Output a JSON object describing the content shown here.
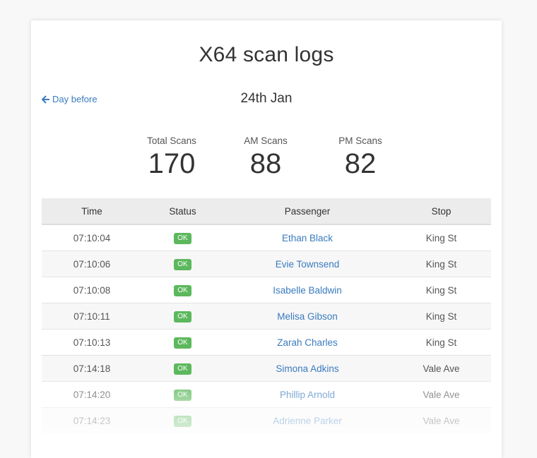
{
  "page": {
    "title": "X64 scan logs",
    "date": "24th Jan",
    "nav": {
      "day_before_label": "Day before"
    }
  },
  "stats": {
    "total": {
      "label": "Total Scans",
      "value": "170"
    },
    "am": {
      "label": "AM Scans",
      "value": "88"
    },
    "pm": {
      "label": "PM Scans",
      "value": "82"
    }
  },
  "table": {
    "headers": [
      "Time",
      "Status",
      "Passenger",
      "Stop"
    ],
    "rows": [
      {
        "time": "07:10:04",
        "status": "OK",
        "passenger": "Ethan Black",
        "stop": "King St"
      },
      {
        "time": "07:10:06",
        "status": "OK",
        "passenger": "Evie Townsend",
        "stop": "King St"
      },
      {
        "time": "07:10:08",
        "status": "OK",
        "passenger": "Isabelle Baldwin",
        "stop": "King St"
      },
      {
        "time": "07:10:11",
        "status": "OK",
        "passenger": "Melisa Gibson",
        "stop": "King St"
      },
      {
        "time": "07:10:13",
        "status": "OK",
        "passenger": "Zarah Charles",
        "stop": "King St"
      },
      {
        "time": "07:14:18",
        "status": "OK",
        "passenger": "Simona Adkins",
        "stop": "Vale Ave"
      },
      {
        "time": "07:14:20",
        "status": "OK",
        "passenger": "Phillip Arnold",
        "stop": "Vale Ave"
      },
      {
        "time": "07:14:23",
        "status": "OK",
        "passenger": "Adrienne Parker",
        "stop": "Vale Ave"
      }
    ]
  },
  "colors": {
    "link": "#3a7bbf",
    "ok_badge": "#5cb85c",
    "header_bg": "#ececec"
  },
  "icons": {
    "back": "arrow-left-icon"
  }
}
